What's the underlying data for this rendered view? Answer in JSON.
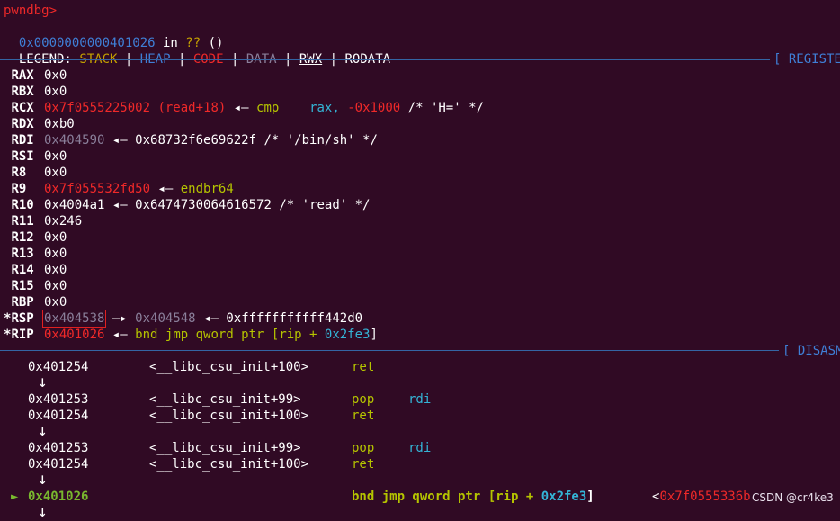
{
  "prompt": "pwndbg>",
  "location": {
    "address": "0x0000000000401026",
    "in": " in ",
    "func": "??",
    "args": " ()"
  },
  "legend": {
    "label": "LEGEND:",
    "stack": "STACK",
    "heap": "HEAP",
    "code": "CODE",
    "data": "DATA",
    "rwx": "RWX",
    "rodata": "RODATA",
    "bar": "|"
  },
  "sections": {
    "registers": "[ REGISTE",
    "disasm": "[ DISASM"
  },
  "registers": [
    {
      "prefix": " ",
      "name": "RAX",
      "value": "0x0"
    },
    {
      "prefix": " ",
      "name": "RBX",
      "value": "0x0"
    },
    {
      "prefix": " ",
      "name": "RCX",
      "value": "0x7f0555225002",
      "extra": "(read+18)",
      "arrow": "◂—",
      "insn": "cmp",
      "ops": "rax, ",
      "imm": "-0x1000",
      "comment": " /* 'H=' */"
    },
    {
      "prefix": " ",
      "name": "RDX",
      "value": "0xb0"
    },
    {
      "prefix": " ",
      "name": "RDI",
      "value": "0x404590",
      "arrow": "◂—",
      "deref": "0x68732f6e69622f /* '/bin/sh' */"
    },
    {
      "prefix": " ",
      "name": "RSI",
      "value": "0x0"
    },
    {
      "prefix": " ",
      "name": "R8",
      "value": "0x0"
    },
    {
      "prefix": " ",
      "name": "R9",
      "value": "0x7f055532fd50",
      "arrow": "◂—",
      "insn": "endbr64"
    },
    {
      "prefix": " ",
      "name": "R10",
      "value": "0x4004a1",
      "arrow": "◂—",
      "deref": "0x6474730064616572 /* 'read' */"
    },
    {
      "prefix": " ",
      "name": "R11",
      "value": "0x246"
    },
    {
      "prefix": " ",
      "name": "R12",
      "value": "0x0"
    },
    {
      "prefix": " ",
      "name": "R13",
      "value": "0x0"
    },
    {
      "prefix": " ",
      "name": "R14",
      "value": "0x0"
    },
    {
      "prefix": " ",
      "name": "R15",
      "value": "0x0"
    },
    {
      "prefix": " ",
      "name": "RBP",
      "value": "0x0"
    },
    {
      "prefix": "*",
      "name": "RSP",
      "value": "0x404538",
      "arrow1": "—▸",
      "ptr": "0x404548",
      "arrow": "◂—",
      "deref": "0xfffffffffff442d0"
    },
    {
      "prefix": "*",
      "name": "RIP",
      "value": "0x401026",
      "arrow": "◂—",
      "insn": "bnd jmp qword ptr [rip + ",
      "imm": "0x2fe3",
      "close": "]"
    }
  ],
  "disasm": [
    {
      "addr": "0x401254",
      "sym": "<__libc_csu_init+100>",
      "insn": "ret",
      "ops": ""
    },
    {
      "addr": "0x401253",
      "sym": "<__libc_csu_init+99>",
      "insn": "pop",
      "ops": "rdi"
    },
    {
      "addr": "0x401254",
      "sym": "<__libc_csu_init+100>",
      "insn": "ret",
      "ops": ""
    },
    {
      "addr": "0x401253",
      "sym": "<__libc_csu_init+99>",
      "insn": "pop",
      "ops": "rdi"
    },
    {
      "addr": "0x401254",
      "sym": "<__libc_csu_init+100>",
      "insn": "ret",
      "ops": ""
    }
  ],
  "current": {
    "marker": "►",
    "addr": "0x401026",
    "insn": "bnd jmp qword ptr [rip + ",
    "imm": "0x2fe3",
    "close": "]",
    "target_lt": "<",
    "target": "0x7f0555336b"
  },
  "down_arrow": "↓",
  "watermark": "CSDN @cr4ke3"
}
